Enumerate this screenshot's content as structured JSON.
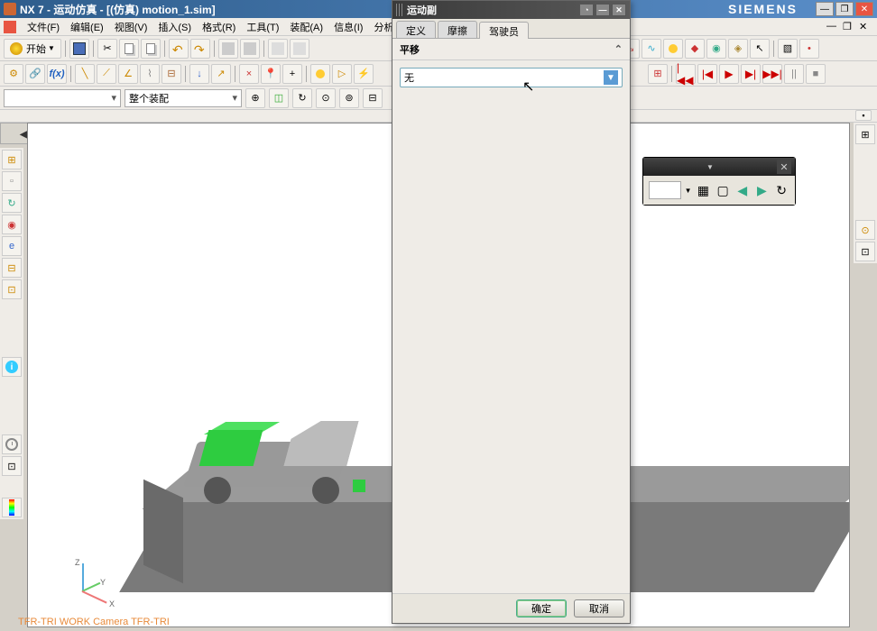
{
  "window": {
    "title": "NX 7 - 运动仿真 - [(仿真) motion_1.sim]",
    "brand": "SIEMENS"
  },
  "menu": {
    "file": "文件(F)",
    "edit": "编辑(E)",
    "view": "视图(V)",
    "insert": "插入(S)",
    "format": "格式(R)",
    "tools": "工具(T)",
    "assembly": "装配(A)",
    "info": "信息(I)",
    "analysis": "分析"
  },
  "toolbar1": {
    "start": "开始"
  },
  "toolbar3": {
    "assembly_combo": "整个装配"
  },
  "playback": {
    "first": "|◀◀",
    "prev": "|◀",
    "play": "▶",
    "next": "▶|",
    "last": "▶▶|",
    "pause": "||",
    "stop": "■"
  },
  "dialog": {
    "title": "运动副",
    "tabs": {
      "define": "定义",
      "friction": "摩擦",
      "driver": "驾驶员"
    },
    "section_translate": "平移",
    "select_value": "无",
    "ok": "确定",
    "cancel": "取消"
  },
  "viewport": {
    "camera_text": "TFR-TRI WORK Camera TFR-TRI",
    "axis_x": "X",
    "axis_y": "Y",
    "axis_z": "Z"
  },
  "float_panel": {
    "title": ""
  }
}
